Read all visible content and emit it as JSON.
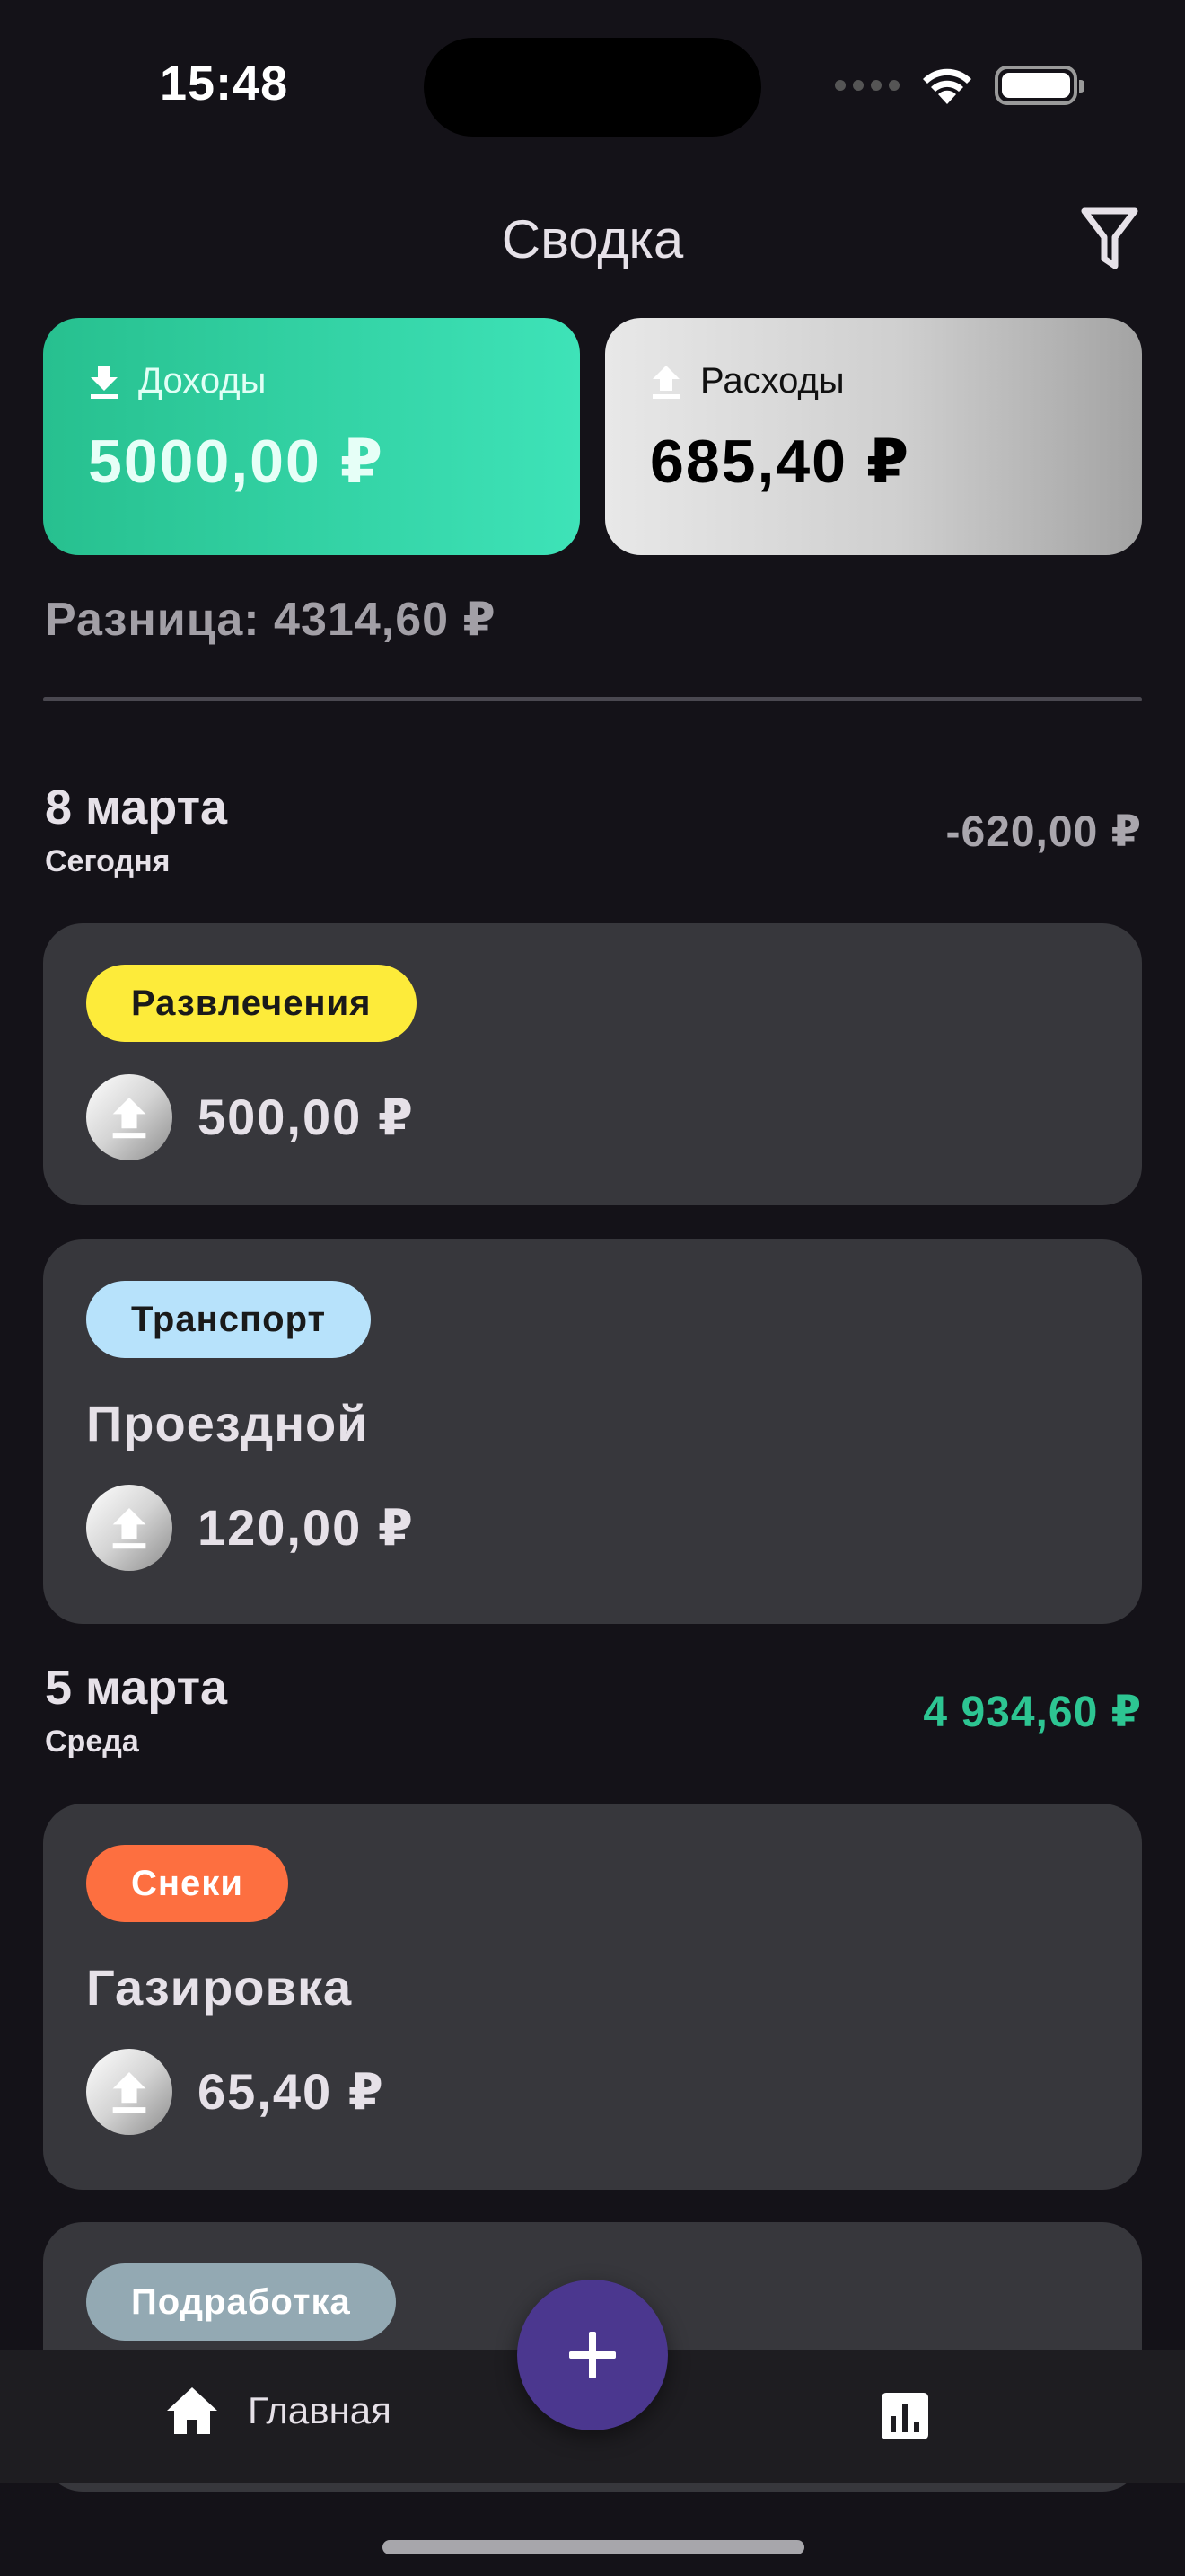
{
  "status_bar": {
    "time": "15:48"
  },
  "header": {
    "title": "Сводка",
    "filter_icon": "filter-icon"
  },
  "summary": {
    "income": {
      "label": "Доходы",
      "amount": "5000,00 ₽",
      "icon": "download-icon"
    },
    "expense": {
      "label": "Расходы",
      "amount": "685,40 ₽",
      "icon": "upload-icon"
    },
    "difference": "Разница: 4314,60 ₽"
  },
  "days": [
    {
      "date": "8 марта",
      "subtitle": "Сегодня",
      "total": "-620,00 ₽",
      "total_color": "#a9a6ad",
      "transactions": [
        {
          "category": "Развлечения",
          "chip_bg": "#fdeb3a",
          "chip_fg": "#1a1a1a",
          "title": "",
          "amount": "500,00 ₽"
        },
        {
          "category": "Транспорт",
          "chip_bg": "#b7e2fb",
          "chip_fg": "#1a1a1a",
          "title": "Проездной",
          "amount": "120,00 ₽"
        }
      ]
    },
    {
      "date": "5 марта",
      "subtitle": "Среда",
      "total": "4 934,60 ₽",
      "total_color": "#2dc592",
      "transactions": [
        {
          "category": "Снеки",
          "chip_bg": "#fd6f40",
          "chip_fg": "#ffffff",
          "title": "Газировка",
          "amount": "65,40 ₽"
        },
        {
          "category": "Подработка",
          "chip_bg": "#93a9b3",
          "chip_fg": "#ffffff",
          "title": "",
          "amount": ""
        }
      ]
    }
  ],
  "bottom_nav": {
    "home_label": "Главная",
    "fab_icon": "plus-icon",
    "stats_icon": "chart-icon"
  }
}
